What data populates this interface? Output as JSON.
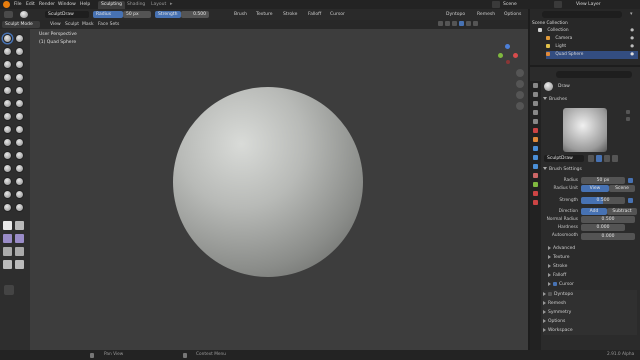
{
  "menubar": {
    "items": [
      "File",
      "Edit",
      "Render",
      "Window",
      "Help"
    ],
    "workspace_tabs": [
      "Sculpting",
      "Shading",
      "Layout"
    ],
    "active_tab": "Sculpting",
    "scene": "Scene",
    "view_layer": "View Layer"
  },
  "tool_settings": {
    "brush_name": "SculptDraw",
    "radius_label": "Radius",
    "radius_value": "50 px",
    "strength_label": "Strength",
    "strength_value": "0.500",
    "menus": [
      "Brush",
      "Texture",
      "Stroke",
      "Falloff",
      "Cursor"
    ],
    "right_menus": [
      "Dyntopo",
      "Remesh",
      "Options"
    ]
  },
  "header": {
    "mode": "Sculpt Mode",
    "menus": [
      "View",
      "Sculpt",
      "Mask",
      "Face Sets"
    ]
  },
  "viewport": {
    "perspective_label": "User Perspective",
    "object_label": "(1) Quad Sphere"
  },
  "outliner": {
    "root": "Scene Collection",
    "items": [
      {
        "name": "Collection",
        "icon": "collection-icon",
        "color": "#d0d0d0"
      },
      {
        "name": "Camera",
        "icon": "camera-icon",
        "color": "#e09a3a"
      },
      {
        "name": "Light",
        "icon": "light-icon",
        "color": "#e0c04a"
      },
      {
        "name": "Quad Sphere",
        "icon": "mesh-icon",
        "color": "#e08a3a"
      }
    ]
  },
  "properties": {
    "brush_row_label": "Draw",
    "brushes_section": "Brushes",
    "brush_name": "SculptDraw",
    "settings_section": "Brush Settings",
    "radius_label": "Radius",
    "radius_value": "50 px",
    "radius_unit_label": "Radius Unit",
    "radius_unit_options": [
      "View",
      "Scene"
    ],
    "strength_label": "Strength",
    "strength_value": "0.500",
    "direction_label": "Direction",
    "direction_options": [
      "Add",
      "Subtract"
    ],
    "normal_radius_label": "Normal Radius",
    "normal_radius_value": "0.500",
    "hardness_label": "Hardness",
    "hardness_value": "0.000",
    "autosmooth_label": "Autosmooth",
    "autosmooth_value": "0.000",
    "subsections": [
      "Advanced",
      "Texture",
      "Stroke",
      "Falloff",
      "Cursor"
    ],
    "panels": [
      "Dyntopo",
      "Remesh",
      "Symmetry",
      "Options",
      "Workspace"
    ]
  },
  "statusbar": {
    "left": "Pan View",
    "middle": "Context Menu",
    "version": "2.91.0 Alpha"
  }
}
